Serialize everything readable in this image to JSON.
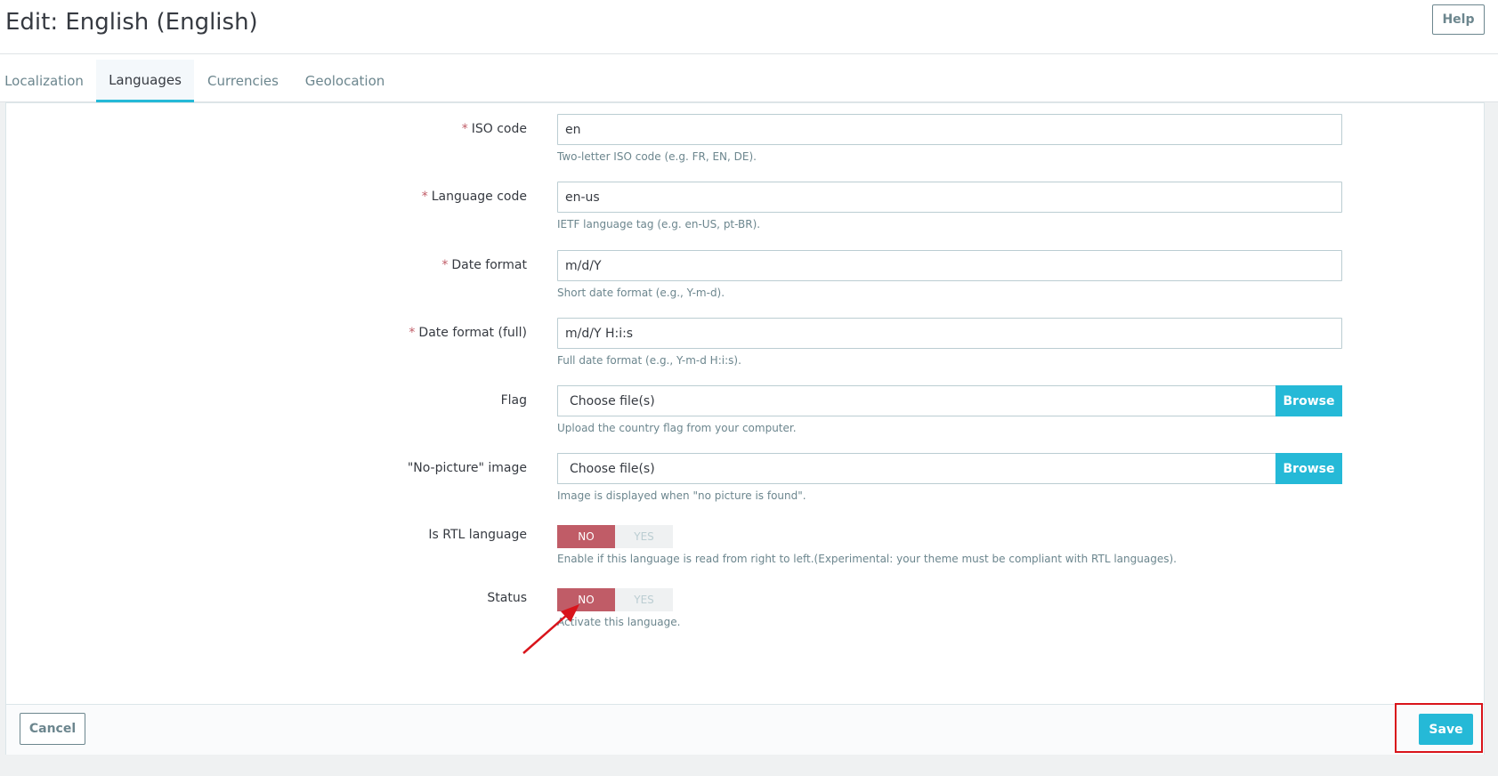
{
  "header": {
    "title": "Edit: English (English)",
    "help_label": "Help"
  },
  "tabs": [
    {
      "label": "Localization",
      "active": false
    },
    {
      "label": "Languages",
      "active": true
    },
    {
      "label": "Currencies",
      "active": false
    },
    {
      "label": "Geolocation",
      "active": false
    }
  ],
  "form": {
    "required_marker": "*",
    "iso_code": {
      "label": "ISO code",
      "value": "en",
      "help": "Two-letter ISO code (e.g. FR, EN, DE)."
    },
    "language_code": {
      "label": "Language code",
      "value": "en-us",
      "help": "IETF language tag (e.g. en-US, pt-BR)."
    },
    "date_format": {
      "label": "Date format",
      "value": "m/d/Y",
      "help": "Short date format (e.g., Y-m-d)."
    },
    "date_format_full": {
      "label": "Date format (full)",
      "value": "m/d/Y H:i:s",
      "help": "Full date format (e.g., Y-m-d H:i:s)."
    },
    "flag": {
      "label": "Flag",
      "file_placeholder": "Choose file(s)",
      "browse_label": "Browse",
      "help": "Upload the country flag from your computer."
    },
    "no_picture": {
      "label": "\"No-picture\" image",
      "file_placeholder": "Choose file(s)",
      "browse_label": "Browse",
      "help": "Image is displayed when \"no picture is found\"."
    },
    "is_rtl": {
      "label": "Is RTL language",
      "no_label": "NO",
      "yes_label": "YES",
      "selected": "NO",
      "help": "Enable if this language is read from right to left.(Experimental: your theme must be compliant with RTL languages)."
    },
    "status": {
      "label": "Status",
      "no_label": "NO",
      "yes_label": "YES",
      "selected": "NO",
      "help": "Activate this language."
    }
  },
  "footer": {
    "cancel_label": "Cancel",
    "save_label": "Save"
  },
  "colors": {
    "accent": "#25b9d7",
    "switch_off_active": "#c05c67",
    "annotation_red": "#d9141b"
  }
}
